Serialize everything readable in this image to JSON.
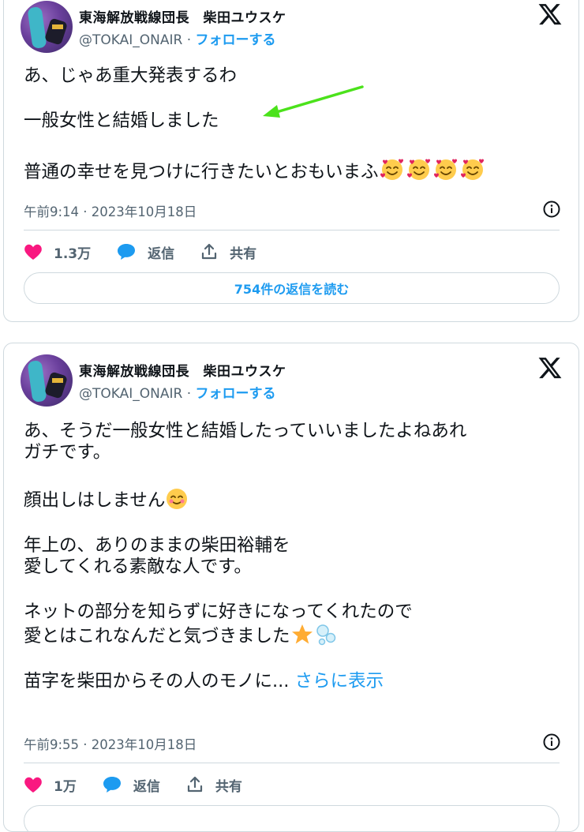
{
  "tweets": [
    {
      "name": "東海解放戦線団長　柴田ユウスケ",
      "handle": "@TOKAI_ONAIR",
      "separator": "·",
      "follow": "フォローする",
      "lines": [
        "あ、じゃあ重大発表するわ",
        "一般女性と結婚しました",
        "普通の幸せを見つけに行きたいとおもいまふ"
      ],
      "timestamp": "午前9:14 · 2023年10月18日",
      "likes": "1.3万",
      "reply_label": "返信",
      "share_label": "共有",
      "read_replies": "754件の返信を読む"
    },
    {
      "name": "東海解放戦線団長　柴田ユウスケ",
      "handle": "@TOKAI_ONAIR",
      "separator": "·",
      "follow": "フォローする",
      "lines": [
        "あ、そうだ一般女性と結婚したっていいましたよねあれ",
        "ガチです。",
        "顔出しはしません",
        "年上の、ありのままの柴田裕輔を",
        "愛してくれる素敵な人です。",
        "ネットの部分を知らずに好きになってくれたので",
        "愛とはこれなんだと気づきました",
        "苗字を柴田からその人のモノに..."
      ],
      "show_more": "さらに表示",
      "timestamp": "午前9:55 · 2023年10月18日",
      "likes": "1万",
      "reply_label": "返信",
      "share_label": "共有"
    }
  ],
  "colors": {
    "accent": "#1d9bf0",
    "like": "#f91880",
    "arrow": "#4be21b",
    "muted": "#536471"
  },
  "icons": [
    "x-logo-icon",
    "info-icon",
    "heart-icon",
    "reply-bubble-icon",
    "share-icon",
    "smiling-face-with-hearts-emoji",
    "smiling-face-emoji",
    "star-emoji",
    "bubbles-emoji",
    "green-arrow-annotation"
  ]
}
